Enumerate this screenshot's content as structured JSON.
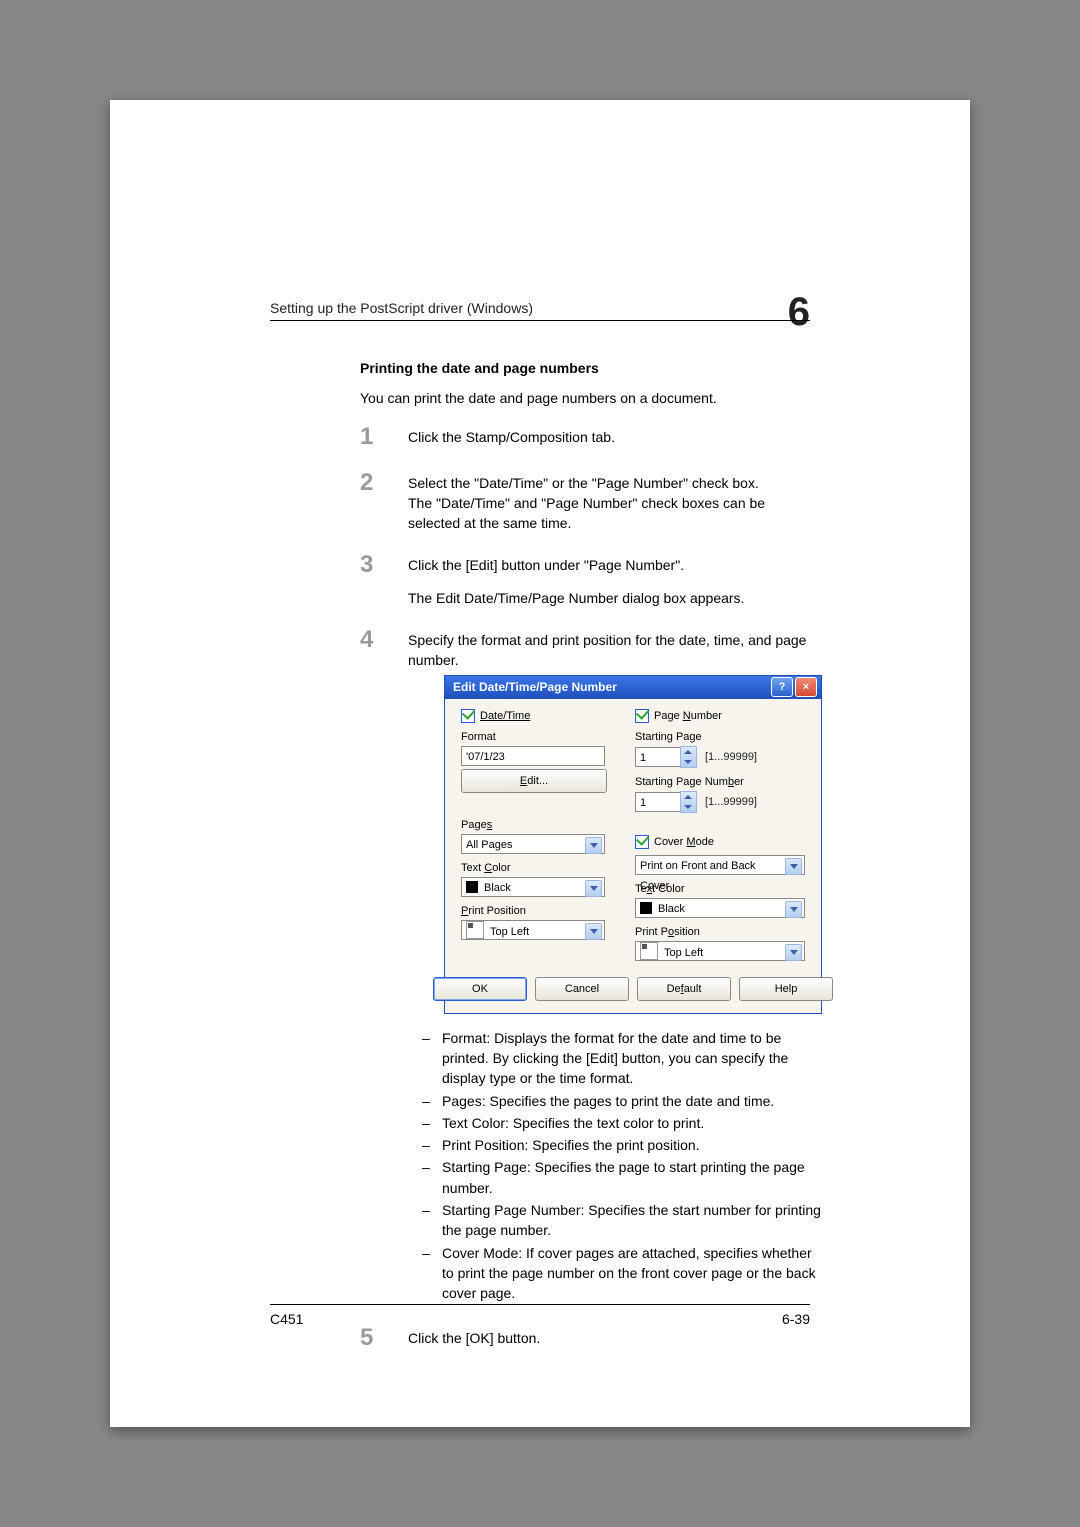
{
  "header": {
    "running": "Setting up the PostScript driver (Windows)",
    "chapter": "6"
  },
  "footer": {
    "model": "C451",
    "pageref": "6-39"
  },
  "section": {
    "title": "Printing the date and page numbers",
    "intro": "You can print the date and page numbers on a document.",
    "steps": {
      "s1": "Click the Stamp/Composition tab.",
      "s2": "Select the \"Date/Time\" or the \"Page Number\" check box.\nThe \"Date/Time\" and \"Page Number\" check boxes can be selected at the same time.",
      "s3a": "Click the [Edit] button under \"Page Number\".",
      "s3b": "The Edit Date/Time/Page Number dialog box appears.",
      "s4": "Specify the format and print position for the date, time, and page number.",
      "s5": "Click the [OK] button."
    },
    "bullets": {
      "b1": "Format: Displays the format for the date and time to be printed. By clicking the [Edit] button, you can specify the display type or the time format.",
      "b2": "Pages: Specifies the pages to print the date and time.",
      "b3": "Text Color: Specifies the text color to print.",
      "b4": "Print Position: Specifies the print position.",
      "b5": "Starting Page: Specifies the page to start printing the page number.",
      "b6": "Starting Page Number: Specifies the start number for printing the page number.",
      "b7": "Cover Mode: If cover pages are attached, specifies whether to print the page number on the front cover page or the back cover page."
    }
  },
  "dialog": {
    "title": "Edit Date/Time/Page Number",
    "left": {
      "datetime": "Date/Time",
      "format": "Format",
      "format_value": "'07/1/23",
      "edit": "Edit...",
      "pages": "Pages",
      "pages_value": "All Pages",
      "textcolor": "Text Color",
      "textcolor_value": "Black",
      "printpos": "Print Position",
      "printpos_value": "Top Left"
    },
    "right": {
      "pagenumber": "Page Number",
      "startpage": "Starting Page",
      "startpage_value": "1",
      "range1": "[1...99999]",
      "startnum": "Starting Page Number",
      "startnum_value": "1",
      "range2": "[1...99999]",
      "covermode": "Cover Mode",
      "covermode_value": "Print on Front and Back Cover",
      "textcolor": "Text Color",
      "textcolor_value": "Black",
      "printpos": "Print Position",
      "printpos_value": "Top Left"
    },
    "buttons": {
      "ok": "OK",
      "cancel": "Cancel",
      "default": "Default",
      "help": "Help"
    }
  }
}
